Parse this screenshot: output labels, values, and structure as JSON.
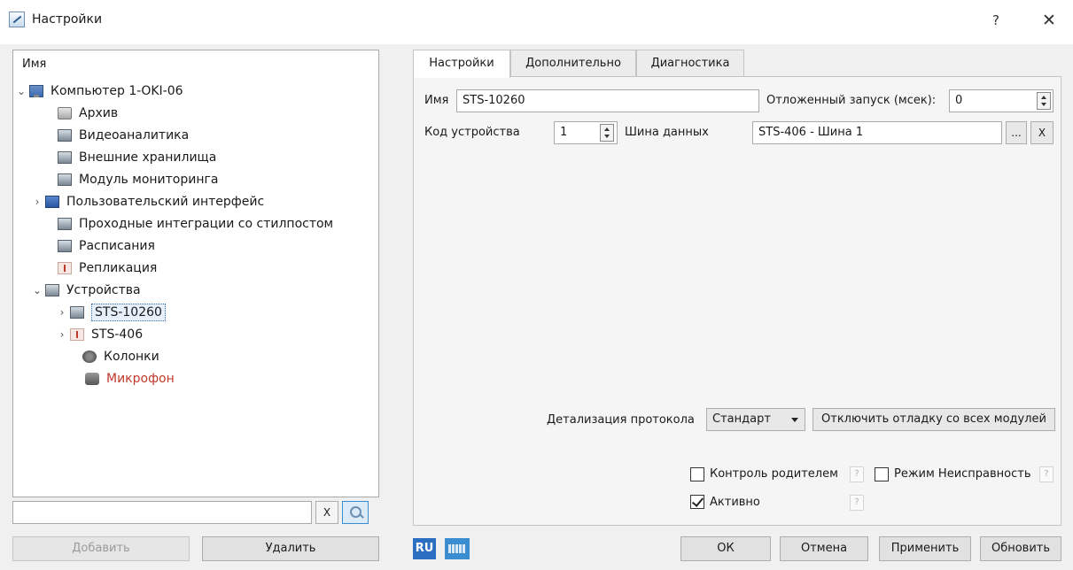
{
  "window": {
    "title": "Настройки",
    "help_label": "?",
    "close_label": "✕"
  },
  "tree": {
    "header": "Имя",
    "items": [
      {
        "label": "Компьютер 1-OKI-06",
        "icon": "computer-icon",
        "expand": "⌄"
      },
      {
        "label": "Архив",
        "icon": "disk-icon",
        "expand": ""
      },
      {
        "label": "Видеоаналитика",
        "icon": "module-icon",
        "expand": ""
      },
      {
        "label": "Внешние хранилища",
        "icon": "module-icon",
        "expand": ""
      },
      {
        "label": "Модуль мониторинга",
        "icon": "module-icon",
        "expand": ""
      },
      {
        "label": "Пользовательский интерфейс",
        "icon": "monitor-icon",
        "expand": "›"
      },
      {
        "label": "Проходные интеграции со стилпостом",
        "icon": "module-icon",
        "expand": ""
      },
      {
        "label": "Расписания",
        "icon": "module-icon",
        "expand": ""
      },
      {
        "label": "Репликация",
        "icon": "replication-icon",
        "expand": ""
      },
      {
        "label": "Устройства",
        "icon": "module-icon",
        "expand": "⌄"
      },
      {
        "label": "STS-10260",
        "icon": "module-icon",
        "expand": "›",
        "selected": true
      },
      {
        "label": "STS-406",
        "icon": "replication-icon",
        "expand": "›"
      },
      {
        "label": "Колонки",
        "icon": "speaker-icon",
        "expand": ""
      },
      {
        "label": "Микрофон",
        "icon": "microphone-icon",
        "expand": "",
        "color": "#c0392b"
      }
    ]
  },
  "search": {
    "value": "",
    "clear_label": "X"
  },
  "left_buttons": {
    "add_label": "Добавить",
    "delete_label": "Удалить"
  },
  "tabs": [
    {
      "label": "Настройки",
      "active": true
    },
    {
      "label": "Дополнительно",
      "active": false
    },
    {
      "label": "Диагностика",
      "active": false
    }
  ],
  "form": {
    "name_label": "Имя",
    "name_value": "STS-10260",
    "delay_label": "Отложенный запуск (мсек):",
    "delay_value": "0",
    "device_code_label": "Код устройства",
    "device_code_value": "1",
    "bus_label": "Шина данных",
    "bus_value": "STS-406 - Шина 1",
    "bus_browse_label": "...",
    "bus_clear_label": "X",
    "protocol_label": "Детализация протокола",
    "protocol_value": "Стандарт",
    "disable_debug_label": "Отключить отладку со всех модулей",
    "parent_control_label": "Контроль родителем",
    "parent_control_checked": false,
    "fault_mode_label": "Режим Неисправность",
    "fault_mode_checked": false,
    "active_label": "Активно",
    "active_checked": true,
    "help_glyph": "?"
  },
  "footer": {
    "lang": "RU",
    "ok_label": "ОК",
    "cancel_label": "Отмена",
    "apply_label": "Применить",
    "refresh_label": "Обновить"
  },
  "colors": {
    "accent": "#3a8dd0",
    "selection": "#e6f0fb",
    "warning_text": "#c0392b"
  }
}
